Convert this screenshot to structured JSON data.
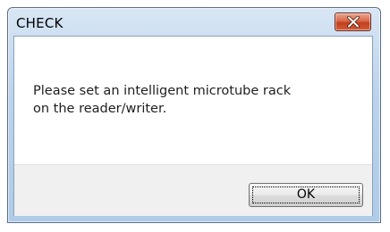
{
  "dialog": {
    "title": "CHECK",
    "message_lines": [
      "Please set an intelligent microtube rack",
      "on the reader/writer."
    ],
    "ok_label": "OK",
    "close_icon": "close-icon",
    "close_color": "#c94b2c"
  }
}
